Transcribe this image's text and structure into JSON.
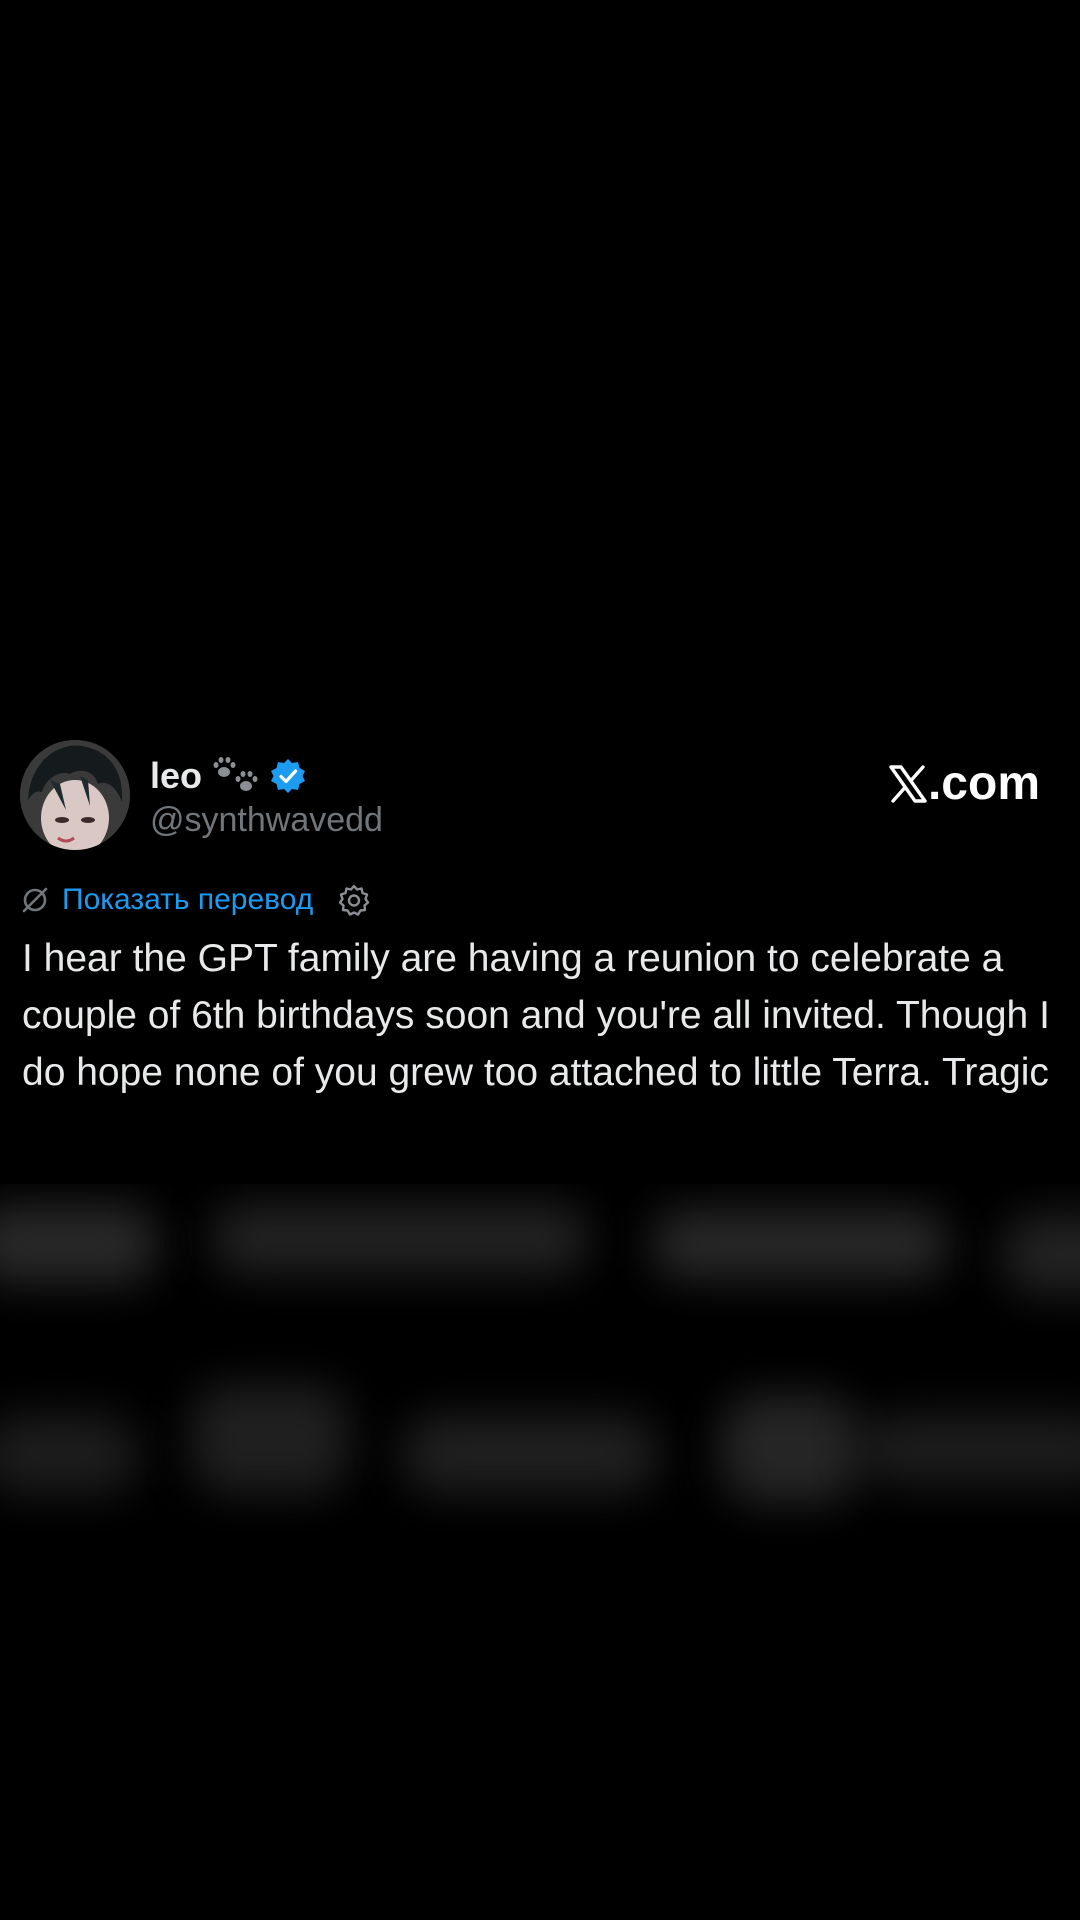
{
  "user": {
    "display_name": "leo",
    "handle": "@synthwavedd",
    "verified": true,
    "name_emoji_icon": "paw-prints-icon",
    "avatar_icon": "avatar-dark-haired-character"
  },
  "brand": {
    "label": ".com",
    "logo_icon": "x-logo-icon"
  },
  "translate": {
    "label": "Показать перевод",
    "icon": "no-translate-icon",
    "settings_icon": "gear-icon"
  },
  "post": {
    "text": "I hear the GPT family are having a reunion to celebrate a couple of 6th birthdays soon and you're all invited. Though I do hope none of you grew too attached to little Terra. Tragic"
  },
  "colors": {
    "background": "#000000",
    "text": "#e7e9ea",
    "handle": "#71767b",
    "link": "#1d9bf0",
    "verified": "#1d9bf0"
  }
}
